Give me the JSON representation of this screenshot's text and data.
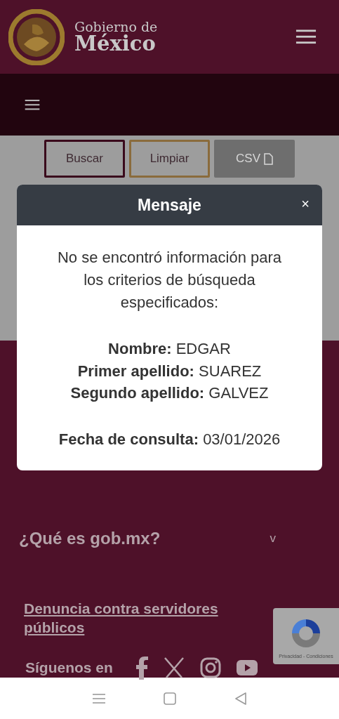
{
  "header": {
    "logo_line1": "Gobierno de",
    "logo_line2": "México"
  },
  "actions": [
    {
      "label": "Buscar",
      "kind": "primary",
      "disabled": false
    },
    {
      "label": "Limpiar",
      "kind": "secondary",
      "disabled": false
    },
    {
      "label": "CSV",
      "kind": "export",
      "disabled": true
    }
  ],
  "modal": {
    "title": "Mensaje",
    "close": "×",
    "message": "No se encontró información para los criterios de búsqueda especificados:",
    "fields": [
      "**Nombre:** EDGAR",
      "**Primer apellido:** SUAREZ",
      "**Segundo apellido:** GALVEZ"
    ],
    "date": "**Fecha de consulta:** 03/01/2026"
  },
  "footer": {
    "accordion": {
      "label": "¿Qué es gob.mx?",
      "toggle": "v",
      "expanded": false
    },
    "link": "Denuncia contra servidores públicos",
    "follow": "Síguenos en",
    "recaptcha": "Privacidad - Condiciones"
  }
}
